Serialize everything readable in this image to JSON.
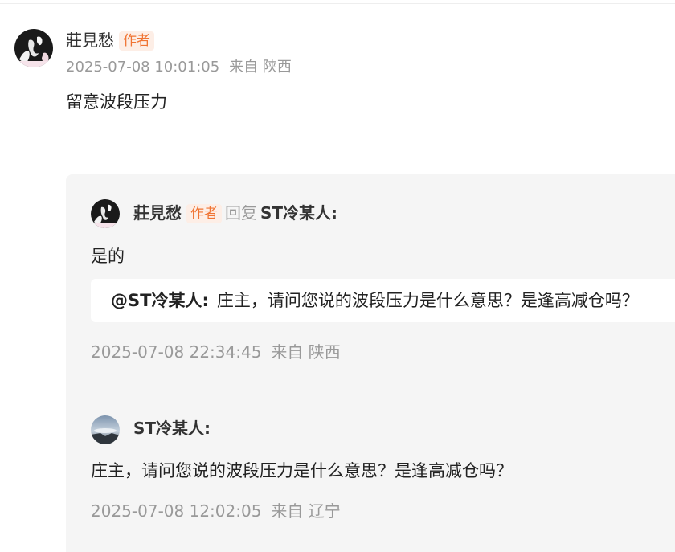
{
  "main_comment": {
    "author": "莊見愁",
    "badge": "作者",
    "timestamp": "2025-07-08 10:01:05",
    "location": "来自 陕西",
    "content": "留意波段压力"
  },
  "replies": [
    {
      "author": "莊見愁",
      "badge": "作者",
      "reply_verb": "回复",
      "reply_to": "ST冷某人:",
      "content": "是的",
      "quote_author": "@ST冷某人:",
      "quote_text": "庄主，请问您说的波段压力是什么意思？是逢高减仓吗？",
      "timestamp": "2025-07-08 22:34:45",
      "location": "来自 陕西"
    },
    {
      "author": "ST冷某人:",
      "content": "庄主，请问您说的波段压力是什么意思？是逢高减仓吗？",
      "timestamp": "2025-07-08 12:02:05",
      "location": "来自 辽宁"
    }
  ],
  "colors": {
    "badge_bg": "#fdeee6",
    "badge_text": "#f07433",
    "meta_text": "#999999",
    "reply_bg": "#f5f5f5"
  }
}
